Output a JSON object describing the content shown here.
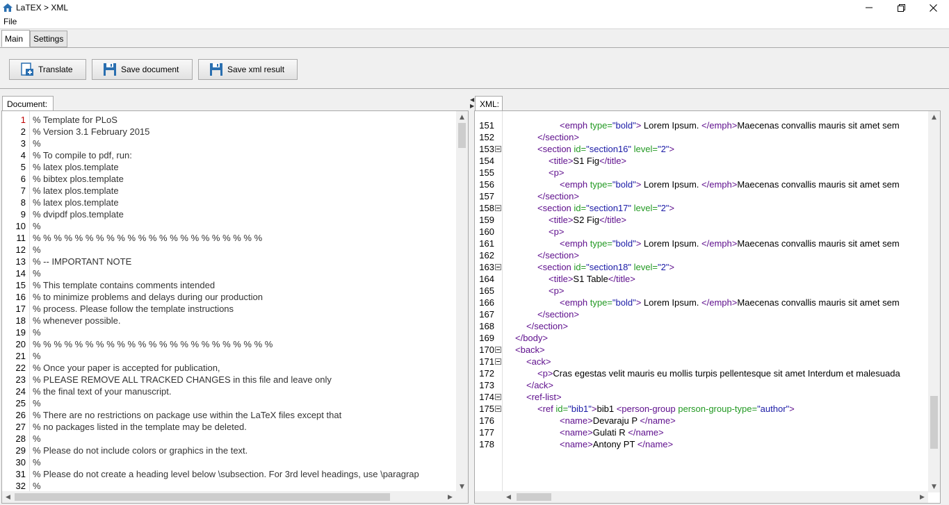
{
  "window": {
    "title": "LaTEX > XML"
  },
  "menu": {
    "file": "File"
  },
  "tabs": {
    "main": "Main",
    "settings": "Settings"
  },
  "toolbar": {
    "translate": "Translate",
    "save_document": "Save document",
    "save_xml": "Save xml result"
  },
  "document_panel": {
    "tab": "Document:",
    "lines": [
      {
        "n": "1",
        "t": "% Template for PLoS"
      },
      {
        "n": "2",
        "t": "% Version 3.1 February 2015"
      },
      {
        "n": "3",
        "t": "%"
      },
      {
        "n": "4",
        "t": "% To compile to pdf, run:"
      },
      {
        "n": "5",
        "t": "% latex plos.template"
      },
      {
        "n": "6",
        "t": "% bibtex plos.template"
      },
      {
        "n": "7",
        "t": "% latex plos.template"
      },
      {
        "n": "8",
        "t": "% latex plos.template"
      },
      {
        "n": "9",
        "t": "% dvipdf plos.template"
      },
      {
        "n": "10",
        "t": "%"
      },
      {
        "n": "11",
        "t": "% % % % % % % % % % % % % % % % % % % % % %"
      },
      {
        "n": "12",
        "t": "%"
      },
      {
        "n": "13",
        "t": "% -- IMPORTANT NOTE"
      },
      {
        "n": "14",
        "t": "%"
      },
      {
        "n": "15",
        "t": "% This template contains comments intended"
      },
      {
        "n": "16",
        "t": "% to minimize problems and delays during our production"
      },
      {
        "n": "17",
        "t": "% process. Please follow the template instructions"
      },
      {
        "n": "18",
        "t": "% whenever possible."
      },
      {
        "n": "19",
        "t": "%"
      },
      {
        "n": "20",
        "t": "% % % % % % % % % % % % % % % % % % % % % % %"
      },
      {
        "n": "21",
        "t": "%"
      },
      {
        "n": "22",
        "t": "% Once your paper is accepted for publication,"
      },
      {
        "n": "23",
        "t": "% PLEASE REMOVE ALL TRACKED CHANGES in this file and leave only"
      },
      {
        "n": "24",
        "t": "% the final text of your manuscript."
      },
      {
        "n": "25",
        "t": "%"
      },
      {
        "n": "26",
        "t": "% There are no restrictions on package use within the LaTeX files except that"
      },
      {
        "n": "27",
        "t": "% no packages listed in the template may be deleted."
      },
      {
        "n": "28",
        "t": "%"
      },
      {
        "n": "29",
        "t": "% Please do not include colors or graphics in the text."
      },
      {
        "n": "30",
        "t": "%"
      },
      {
        "n": "31",
        "t": "% Please do not create a heading level below \\subsection. For 3rd level headings, use \\paragrap"
      },
      {
        "n": "32",
        "t": "%"
      }
    ]
  },
  "xml_panel": {
    "tab": "XML:",
    "lines": [
      {
        "n": "151",
        "indent": 4,
        "parts": [
          [
            "tag",
            "<emph "
          ],
          [
            "attr",
            "type="
          ],
          [
            "val",
            "\"bold\""
          ],
          [
            "tag",
            ">"
          ],
          [
            "txt",
            " Lorem Ipsum. "
          ],
          [
            "tag",
            "</emph>"
          ],
          [
            "txt",
            "Maecenas convallis mauris sit amet sem"
          ]
        ]
      },
      {
        "n": "152",
        "indent": 2,
        "parts": [
          [
            "tag",
            "</section>"
          ]
        ]
      },
      {
        "n": "153",
        "indent": 2,
        "fold": true,
        "parts": [
          [
            "tag",
            "<section "
          ],
          [
            "attr",
            "id="
          ],
          [
            "val",
            "\"section16\" "
          ],
          [
            "attr",
            "level="
          ],
          [
            "val",
            "\"2\""
          ],
          [
            "tag",
            ">"
          ]
        ]
      },
      {
        "n": "154",
        "indent": 3,
        "parts": [
          [
            "tag",
            "<title>"
          ],
          [
            "txt",
            "S1 Fig"
          ],
          [
            "tag",
            "</title>"
          ]
        ]
      },
      {
        "n": "155",
        "indent": 3,
        "parts": [
          [
            "tag",
            "<p>"
          ]
        ]
      },
      {
        "n": "156",
        "indent": 4,
        "parts": [
          [
            "tag",
            "<emph "
          ],
          [
            "attr",
            "type="
          ],
          [
            "val",
            "\"bold\""
          ],
          [
            "tag",
            ">"
          ],
          [
            "txt",
            " Lorem Ipsum. "
          ],
          [
            "tag",
            "</emph>"
          ],
          [
            "txt",
            "Maecenas convallis mauris sit amet sem"
          ]
        ]
      },
      {
        "n": "157",
        "indent": 2,
        "parts": [
          [
            "tag",
            "</section>"
          ]
        ]
      },
      {
        "n": "158",
        "indent": 2,
        "fold": true,
        "parts": [
          [
            "tag",
            "<section "
          ],
          [
            "attr",
            "id="
          ],
          [
            "val",
            "\"section17\" "
          ],
          [
            "attr",
            "level="
          ],
          [
            "val",
            "\"2\""
          ],
          [
            "tag",
            ">"
          ]
        ]
      },
      {
        "n": "159",
        "indent": 3,
        "parts": [
          [
            "tag",
            "<title>"
          ],
          [
            "txt",
            "S2 Fig"
          ],
          [
            "tag",
            "</title>"
          ]
        ]
      },
      {
        "n": "160",
        "indent": 3,
        "parts": [
          [
            "tag",
            "<p>"
          ]
        ]
      },
      {
        "n": "161",
        "indent": 4,
        "parts": [
          [
            "tag",
            "<emph "
          ],
          [
            "attr",
            "type="
          ],
          [
            "val",
            "\"bold\""
          ],
          [
            "tag",
            ">"
          ],
          [
            "txt",
            " Lorem Ipsum. "
          ],
          [
            "tag",
            "</emph>"
          ],
          [
            "txt",
            "Maecenas convallis mauris sit amet sem"
          ]
        ]
      },
      {
        "n": "162",
        "indent": 2,
        "parts": [
          [
            "tag",
            "</section>"
          ]
        ]
      },
      {
        "n": "163",
        "indent": 2,
        "fold": true,
        "parts": [
          [
            "tag",
            "<section "
          ],
          [
            "attr",
            "id="
          ],
          [
            "val",
            "\"section18\" "
          ],
          [
            "attr",
            "level="
          ],
          [
            "val",
            "\"2\""
          ],
          [
            "tag",
            ">"
          ]
        ]
      },
      {
        "n": "164",
        "indent": 3,
        "parts": [
          [
            "tag",
            "<title>"
          ],
          [
            "txt",
            "S1 Table"
          ],
          [
            "tag",
            "</title>"
          ]
        ]
      },
      {
        "n": "165",
        "indent": 3,
        "parts": [
          [
            "tag",
            "<p>"
          ]
        ]
      },
      {
        "n": "166",
        "indent": 4,
        "parts": [
          [
            "tag",
            "<emph "
          ],
          [
            "attr",
            "type="
          ],
          [
            "val",
            "\"bold\""
          ],
          [
            "tag",
            ">"
          ],
          [
            "txt",
            " Lorem Ipsum. "
          ],
          [
            "tag",
            "</emph>"
          ],
          [
            "txt",
            "Maecenas convallis mauris sit amet sem"
          ]
        ]
      },
      {
        "n": "167",
        "indent": 2,
        "parts": [
          [
            "tag",
            "</section>"
          ]
        ]
      },
      {
        "n": "168",
        "indent": 1,
        "parts": [
          [
            "tag",
            "</section>"
          ]
        ]
      },
      {
        "n": "169",
        "indent": 0,
        "parts": [
          [
            "tag",
            "</body>"
          ]
        ]
      },
      {
        "n": "170",
        "indent": 0,
        "fold": true,
        "parts": [
          [
            "tag",
            "<back>"
          ]
        ]
      },
      {
        "n": "171",
        "indent": 1,
        "fold": true,
        "parts": [
          [
            "tag",
            "<ack>"
          ]
        ]
      },
      {
        "n": "172",
        "indent": 2,
        "parts": [
          [
            "tag",
            "<p>"
          ],
          [
            "txt",
            "Cras egestas velit mauris eu mollis turpis pellentesque sit amet Interdum et malesuada"
          ]
        ]
      },
      {
        "n": "173",
        "indent": 1,
        "parts": [
          [
            "tag",
            "</ack>"
          ]
        ]
      },
      {
        "n": "174",
        "indent": 1,
        "fold": true,
        "parts": [
          [
            "tag",
            "<ref-list>"
          ]
        ]
      },
      {
        "n": "175",
        "indent": 2,
        "fold": true,
        "parts": [
          [
            "tag",
            "<ref "
          ],
          [
            "attr",
            "id="
          ],
          [
            "val",
            "\"bib1\""
          ],
          [
            "tag",
            ">"
          ],
          [
            "txt",
            "bib1 "
          ],
          [
            "tag",
            "<person-group "
          ],
          [
            "attr",
            "person-group-type="
          ],
          [
            "val",
            "\"author\""
          ],
          [
            "tag",
            ">"
          ]
        ]
      },
      {
        "n": "176",
        "indent": 4,
        "parts": [
          [
            "tag",
            "<name>"
          ],
          [
            "txt",
            "Devaraju P "
          ],
          [
            "tag",
            "</name>"
          ]
        ]
      },
      {
        "n": "177",
        "indent": 4,
        "parts": [
          [
            "tag",
            "<name>"
          ],
          [
            "txt",
            "Gulati R "
          ],
          [
            "tag",
            "</name>"
          ]
        ]
      },
      {
        "n": "178",
        "indent": 4,
        "parts": [
          [
            "tag",
            "<name>"
          ],
          [
            "txt",
            "Antony PT "
          ],
          [
            "tag",
            "</name>"
          ]
        ]
      }
    ]
  },
  "icons": {
    "app": "home-icon",
    "translate": "translate-icon",
    "save": "floppy-disk-icon",
    "minimize": "minimize-icon",
    "restore": "restore-icon",
    "close": "close-icon"
  },
  "colors": {
    "tag": "#5d0d8c",
    "attr": "#229922",
    "value": "#1a1aa6",
    "line_number_current": "#c00000"
  }
}
